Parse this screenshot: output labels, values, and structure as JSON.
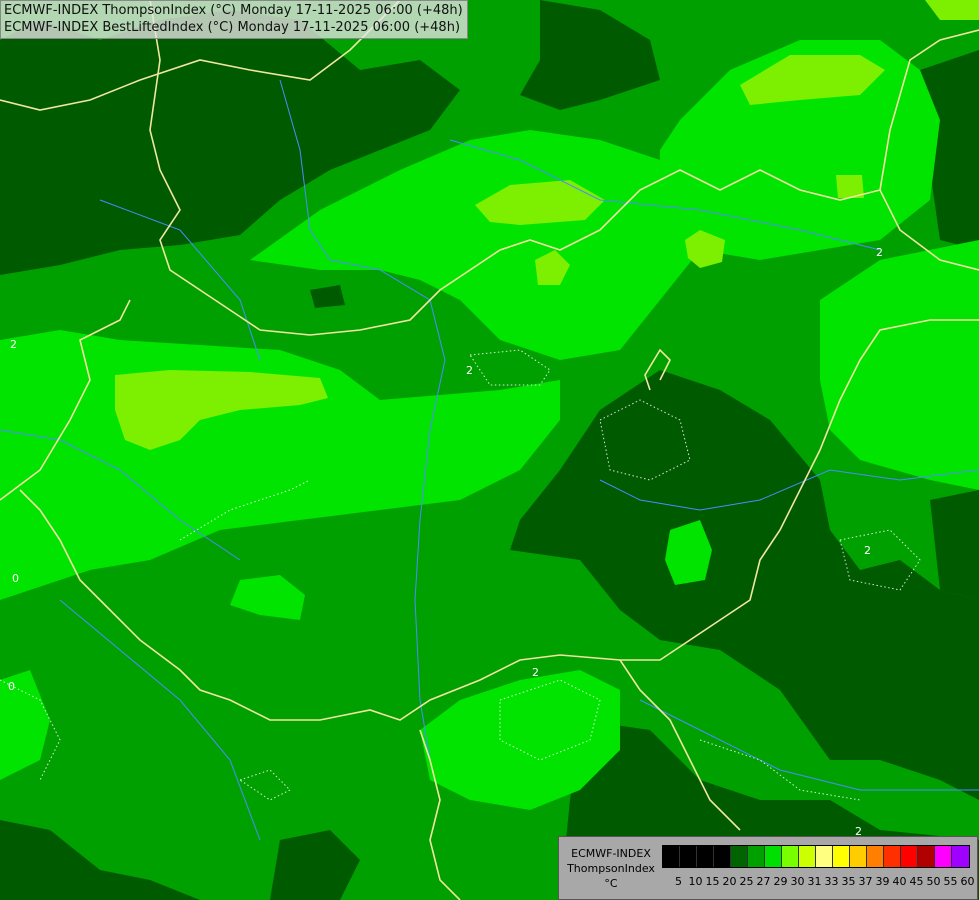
{
  "header": {
    "line1": "ECMWF-INDEX ThompsonIndex (°C) Monday 17-11-2025 06:00 (+48h)",
    "line2": "ECMWF-INDEX BestLiftedIndex (°C) Monday 17-11-2025 06:00 (+48h)"
  },
  "contour_labels": {
    "a": "2",
    "b": "2",
    "c": "2",
    "d": "2",
    "e": "0",
    "f": "0",
    "g": "2",
    "h": "2"
  },
  "legend": {
    "line1": "ECMWF-INDEX",
    "line2": "ThompsonIndex",
    "unit": "°C",
    "values": [
      "5",
      "10",
      "15",
      "20",
      "25",
      "27",
      "29",
      "30",
      "31",
      "33",
      "35",
      "37",
      "39",
      "40",
      "45",
      "50",
      "55",
      "60"
    ],
    "colors": [
      "#000000",
      "#000000",
      "#000000",
      "#000000",
      "#006400",
      "#00a000",
      "#00e000",
      "#78ff00",
      "#ccff00",
      "#ffff80",
      "#ffff00",
      "#ffcc00",
      "#ff8000",
      "#ff3000",
      "#ff0000",
      "#b00000",
      "#ff00ff",
      "#a000ff",
      "#6000ff",
      "#0000ff"
    ]
  },
  "colors": {
    "dark_green": "#005a00",
    "mid_green": "#00a000",
    "bright_green": "#00e400",
    "lime": "#7cf000",
    "yellow_green": "#ccff00",
    "border": "#f0e6a0",
    "river": "#4a8cff"
  }
}
